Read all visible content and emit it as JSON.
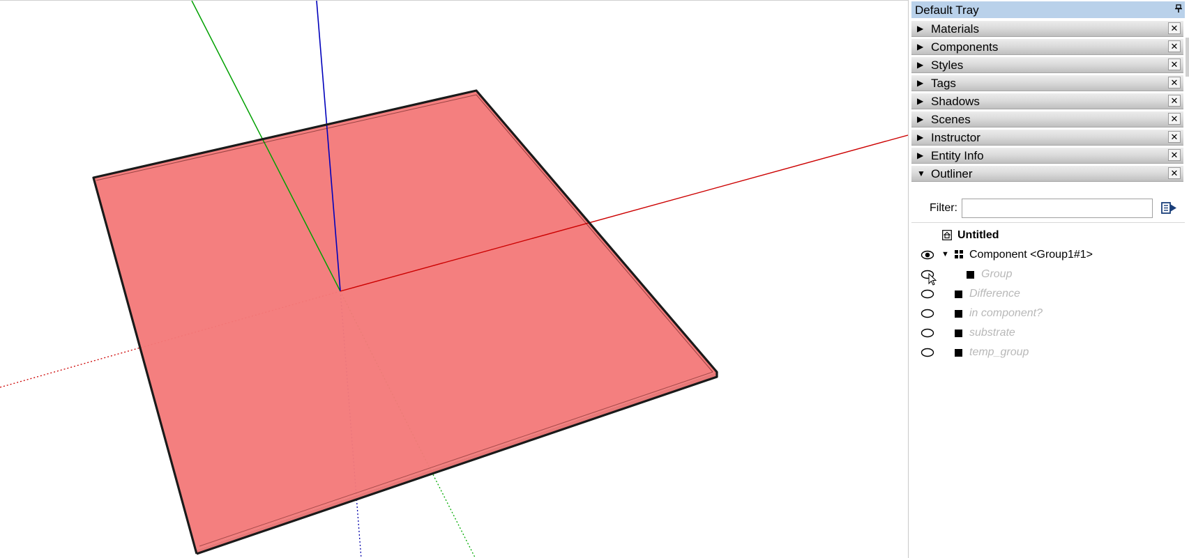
{
  "viewport": {
    "face_color": "#f47a7a",
    "axis_colors": {
      "red": "#cc0000",
      "green": "#00aa00",
      "blue": "#0000cc"
    }
  },
  "tray": {
    "title": "Default Tray",
    "pin_icon": "pin-icon",
    "title_bg": "#b9d1ea",
    "panels": [
      {
        "label": "Materials",
        "expanded": false,
        "arrow": "▶"
      },
      {
        "label": "Components",
        "expanded": false,
        "arrow": "▶"
      },
      {
        "label": "Styles",
        "expanded": false,
        "arrow": "▶"
      },
      {
        "label": "Tags",
        "expanded": false,
        "arrow": "▶"
      },
      {
        "label": "Shadows",
        "expanded": false,
        "arrow": "▶"
      },
      {
        "label": "Scenes",
        "expanded": false,
        "arrow": "▶"
      },
      {
        "label": "Instructor",
        "expanded": false,
        "arrow": "▶"
      },
      {
        "label": "Entity Info",
        "expanded": false,
        "arrow": "▶"
      },
      {
        "label": "Outliner",
        "expanded": true,
        "arrow": "▼"
      }
    ],
    "close_label": "✕"
  },
  "outliner": {
    "filter_label": "Filter:",
    "filter_value": "",
    "filter_placeholder": "",
    "options_icon": "details-arrow-icon",
    "tree": [
      {
        "label": "Untitled",
        "icon": "model-icon",
        "visible_eye": null,
        "bold": true,
        "hidden": false,
        "toggle": ""
      },
      {
        "label": "Component <Group1#1>",
        "icon": "component-icon",
        "visible_eye": "open",
        "bold": false,
        "hidden": false,
        "toggle": "▼"
      },
      {
        "label": "Group",
        "icon": "group-icon",
        "visible_eye": "closed",
        "bold": false,
        "hidden": true,
        "toggle": ""
      },
      {
        "label": "Difference",
        "icon": "group-icon",
        "visible_eye": "closed",
        "bold": false,
        "hidden": true,
        "toggle": ""
      },
      {
        "label": "in component?",
        "icon": "group-icon",
        "visible_eye": "closed",
        "bold": false,
        "hidden": true,
        "toggle": ""
      },
      {
        "label": "substrate",
        "icon": "group-icon",
        "visible_eye": "closed",
        "bold": false,
        "hidden": true,
        "toggle": ""
      },
      {
        "label": "temp_group",
        "icon": "group-icon",
        "visible_eye": "closed",
        "bold": false,
        "hidden": true,
        "toggle": ""
      }
    ]
  }
}
